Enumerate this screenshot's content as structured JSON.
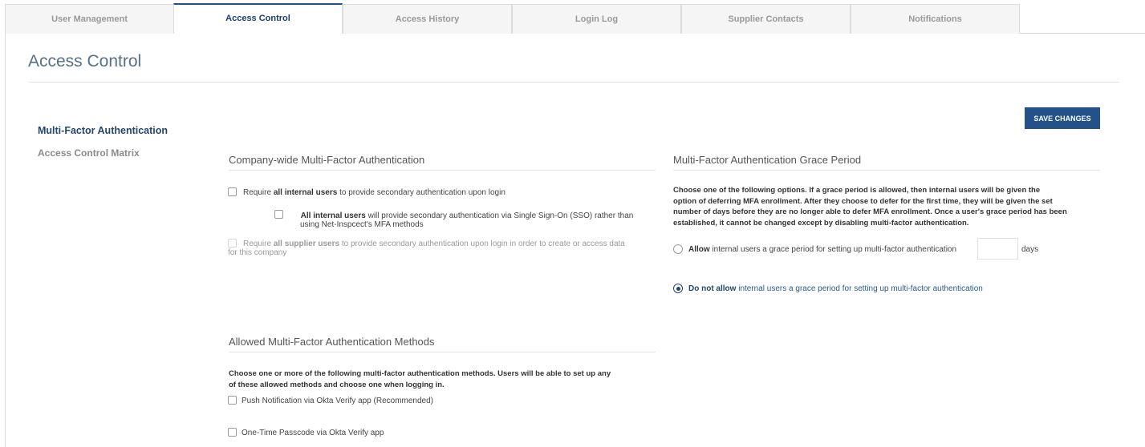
{
  "tabs": [
    {
      "label": "User Management",
      "active": false
    },
    {
      "label": "Access Control",
      "active": true
    },
    {
      "label": "Access History",
      "active": false
    },
    {
      "label": "Login Log",
      "active": false
    },
    {
      "label": "Supplier Contacts",
      "active": false
    },
    {
      "label": "Notifications",
      "active": false
    }
  ],
  "page": {
    "title": "Access Control"
  },
  "sidebar": {
    "items": [
      {
        "label": "Multi-Factor Authentication",
        "active": true
      },
      {
        "label": "Access Control Matrix",
        "active": false
      }
    ]
  },
  "toolbar": {
    "save_label": "SAVE CHANGES"
  },
  "company_mfa": {
    "title": "Company-wide Multi-Factor Authentication",
    "opt1": {
      "pre": "Require ",
      "bold": "all internal users",
      "post": " to provide secondary authentication upon login",
      "checked": false
    },
    "opt2": {
      "bold": "All internal users",
      "post": " will provide secondary authentication via Single Sign-On (SSO) rather than",
      "line2": "using Net-Inspcect's MFA methods",
      "checked": false
    },
    "opt3": {
      "pre": "Require ",
      "bold": "all supplier users",
      "post": " to provide secondary authentication upon login in order to create or access data",
      "line2": "for this company",
      "checked": false,
      "disabled": true
    }
  },
  "grace": {
    "title": "Multi-Factor Authentication Grace Period",
    "desc_pre": "Choose ",
    "desc_one": "one",
    "desc_mid": " of the following options. If a grace period is ",
    "desc_allowed": "allowed",
    "desc_post": ", then internal users will be given the",
    "desc_line2": "option of deferring MFA enrollment. After they choose to defer for the first time, they will be given the set",
    "desc_line3": "number of days before they are no longer able to defer MFA enrollment. Once a user's grace period has been",
    "desc_line4": "established, it cannot be changed except by disabling multi-factor authentication.",
    "allow": {
      "bold": "Allow",
      "post": " internal users a grace period for setting up multi-factor authentication",
      "selected": false
    },
    "days_value": "",
    "days_label": "days",
    "disallow": {
      "bold": "Do not allow",
      "post": " internal users a grace period for setting up multi-factor authentication",
      "selected": true
    }
  },
  "methods": {
    "title": "Allowed Multi-Factor Authentication Methods",
    "desc_line1": "Choose one or more of the following multi-factor authentication methods. Users will be able to set up any",
    "desc_line2": "of these allowed methods and choose one when logging in.",
    "items": [
      {
        "label": "Push Notification via Okta Verify app (Recommended)",
        "checked": false
      },
      {
        "label": "One-Time Passcode via Okta Verify app",
        "checked": false
      }
    ]
  }
}
